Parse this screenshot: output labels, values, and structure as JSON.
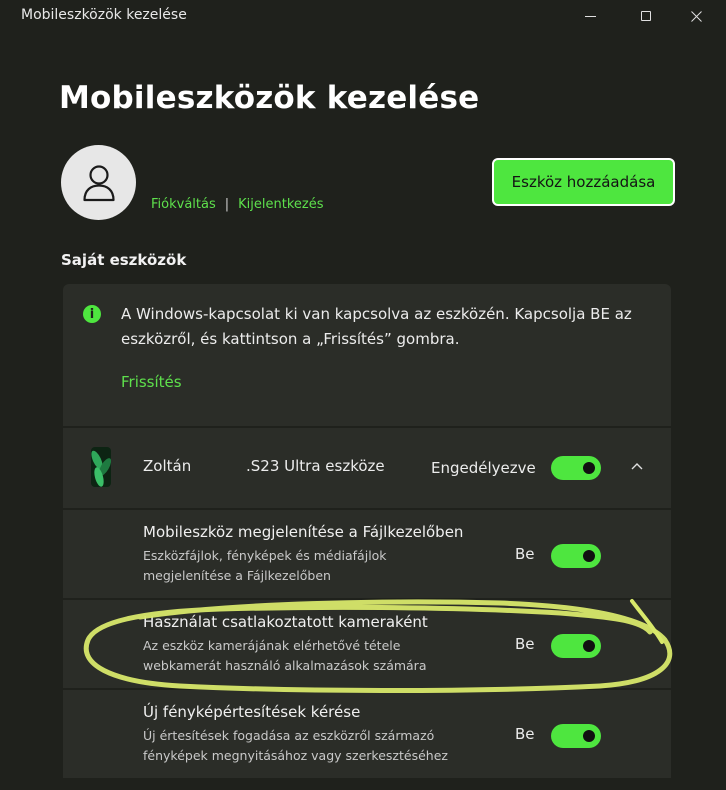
{
  "window": {
    "title": "Mobileszközök kezelése"
  },
  "page": {
    "title": "Mobileszközök kezelése"
  },
  "account": {
    "switch_link": "Fiókváltás",
    "separator": "|",
    "signout_link": "Kijelentkezés",
    "add_device_button": "Eszköz hozzáadása"
  },
  "section": {
    "title": "Saját eszközök"
  },
  "info": {
    "message": "A Windows-kapcsolat ki van kapcsolva az eszközén. Kapcsolja BE az eszközről, és kattintson a „Frissítés” gombra.",
    "refresh_link": "Frissítés"
  },
  "device": {
    "owner": "Zoltán",
    "model": ".S23 Ultra eszköze",
    "status": "Engedélyezve",
    "enabled": true
  },
  "settings": [
    {
      "title": "Mobileszköz megjelenítése a Fájlkezelőben",
      "description": "Eszközfájlok, fényképek és médiafájlok megjelenítése a Fájlkezelőben",
      "state": "Be",
      "enabled": true
    },
    {
      "title": "Használat csatlakoztatott kameraként",
      "description": "Az eszköz kamerájának elérhetővé tétele webkamerát használó alkalmazások számára",
      "state": "Be",
      "enabled": true
    },
    {
      "title": "Új fényképértesítések kérése",
      "description": "Új értesítések fogadása az eszközről származó fényképek megnyitásához vagy szerkesztéséhez",
      "state": "Be",
      "enabled": true
    }
  ],
  "colors": {
    "accent": "#4ee63f",
    "link": "#5ee04c",
    "background": "#1f211c",
    "panel": "#2b2d28",
    "annotation": "#d8e86a"
  }
}
